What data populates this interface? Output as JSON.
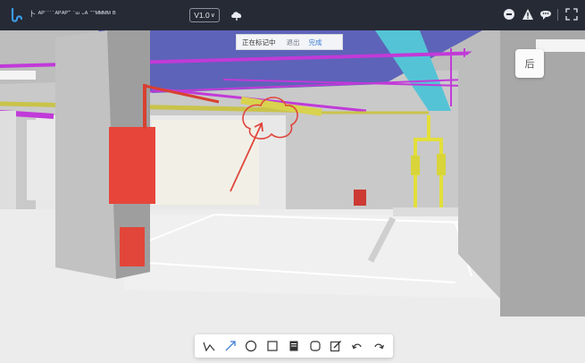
{
  "header": {
    "file_name": "卜 ᴬᴾ˙˙˙˙ᴬᴾᴬᴾˆ ˙ᵚ ᵕᴬ ˉˉᴹᴹᴹᴹ ᴮ",
    "version": "V1.0",
    "icons": [
      "app-logo-icon",
      "cloud-icon",
      "comment-icon",
      "warning-icon",
      "chat-icon",
      "fullscreen-icon"
    ]
  },
  "marking": {
    "status": "正在标记中",
    "exit": "退出",
    "done": "完成"
  },
  "view": {
    "back_label": "后"
  },
  "toolbar": {
    "tools": [
      "polyline-icon",
      "arrow-icon",
      "circle-icon",
      "rectangle-icon",
      "note-icon",
      "rounded-rect-icon",
      "pen-icon",
      "undo-icon",
      "redo-icon"
    ]
  },
  "colors": {
    "topbar": "#262a35",
    "accent": "#3a7bd5",
    "markup_red": "#e0453d"
  }
}
